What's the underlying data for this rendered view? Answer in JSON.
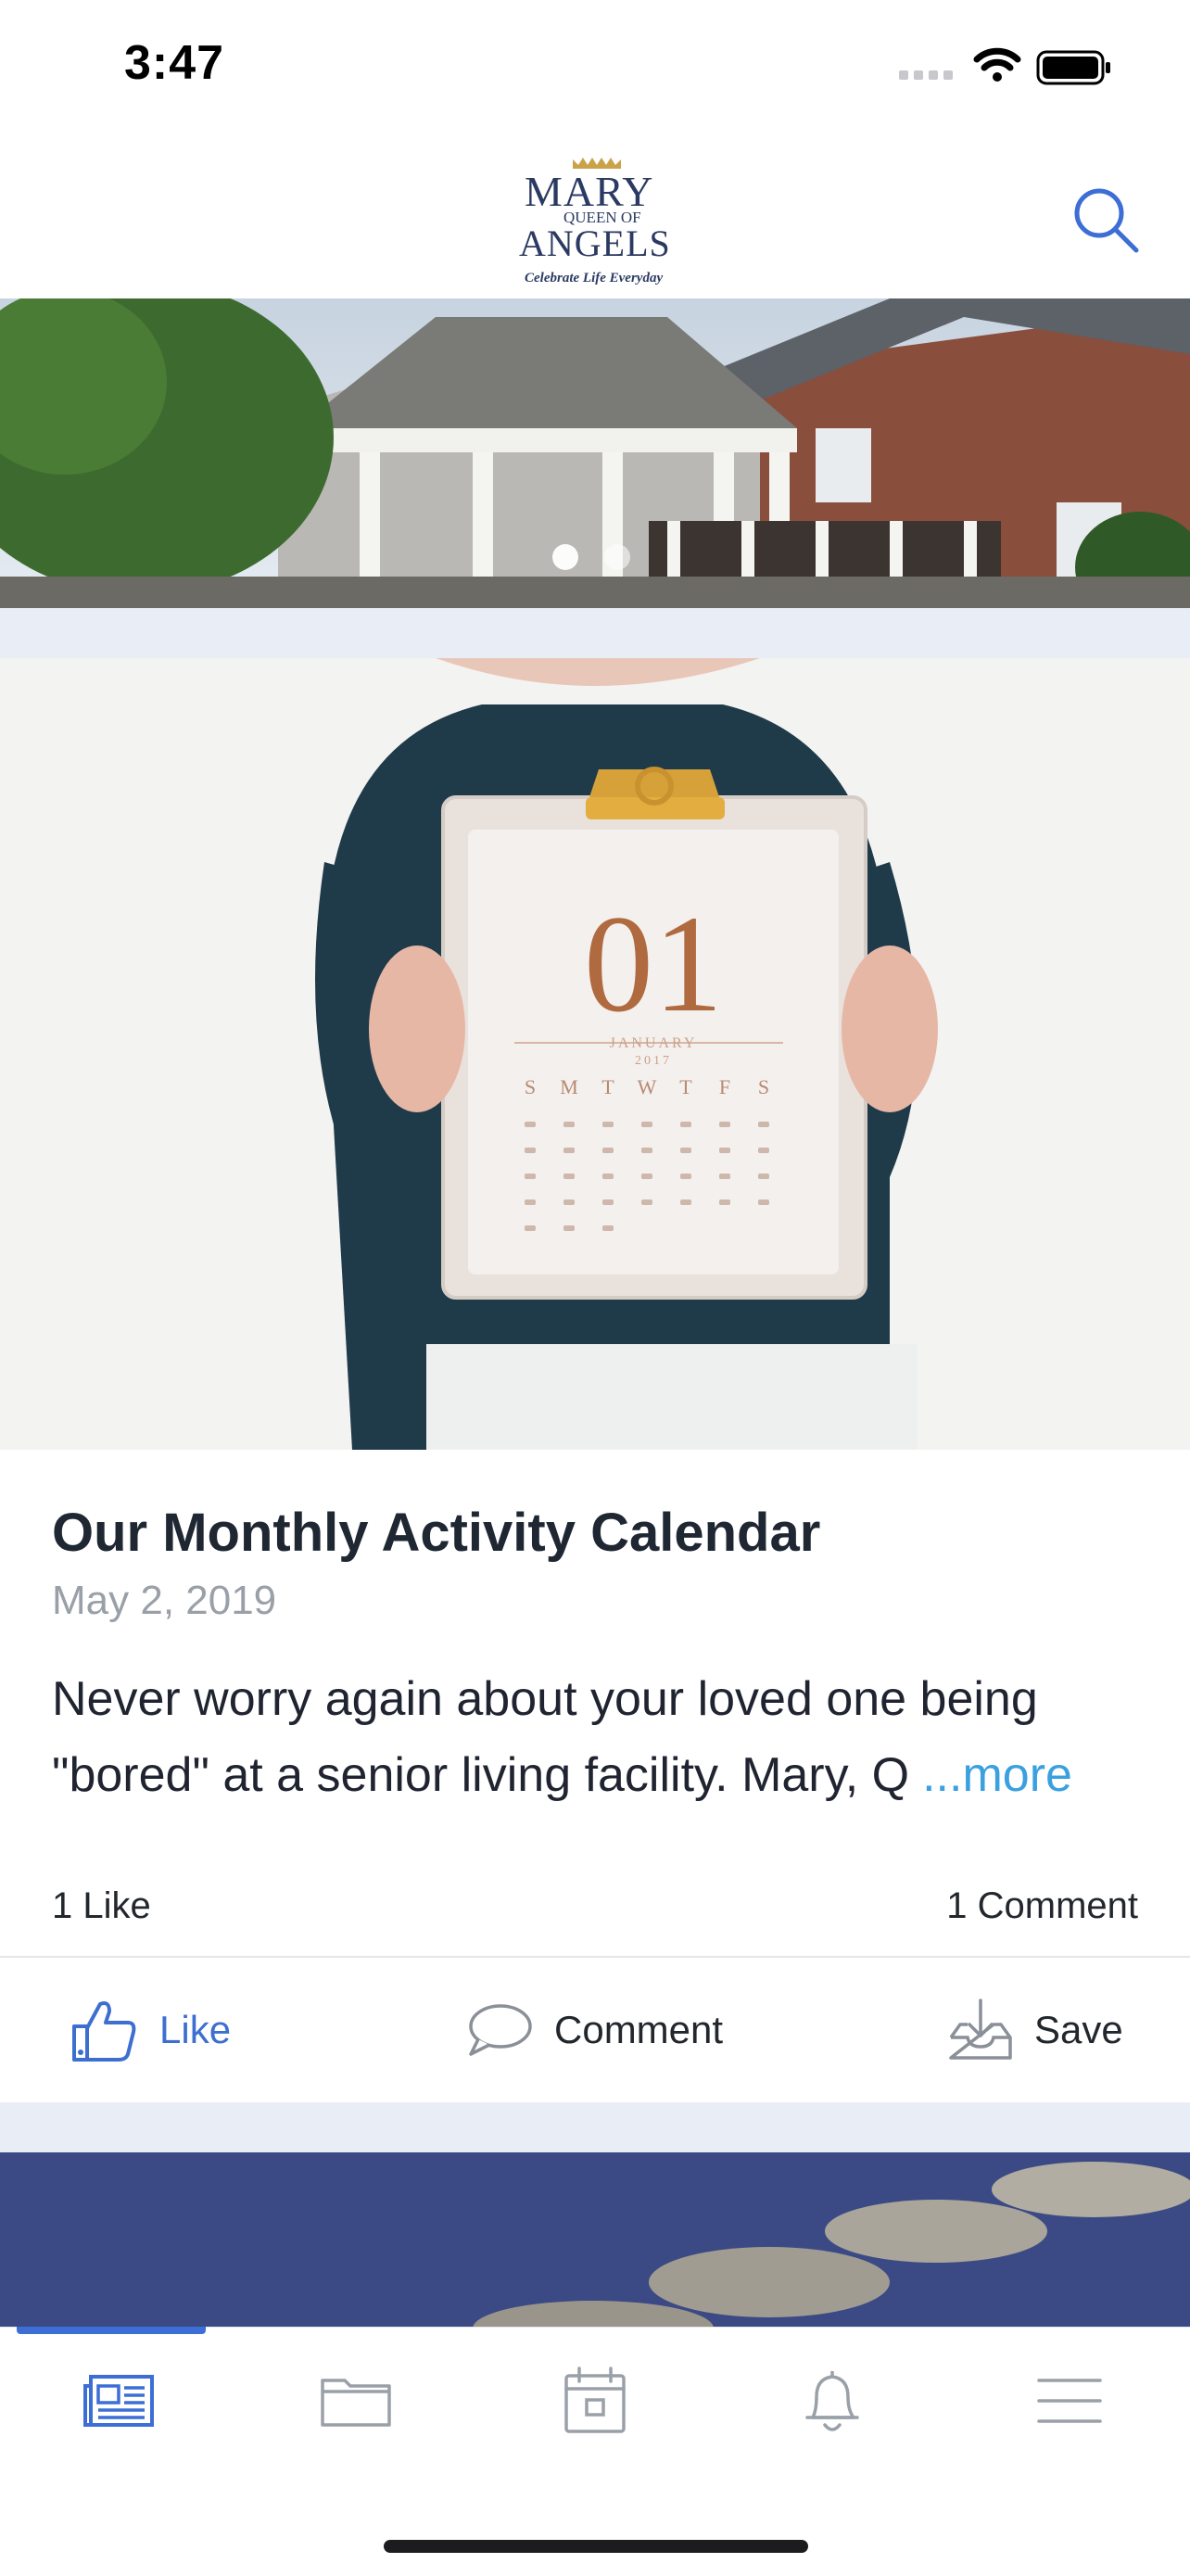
{
  "status_bar": {
    "time": "3:47"
  },
  "header": {
    "logo": {
      "line1": "MARY",
      "line2": "QUEEN OF",
      "line3": "ANGELS",
      "tagline": "Celebrate Life Everyday"
    },
    "search_icon": "search-icon"
  },
  "carousel": {
    "slide_count": 2,
    "active_index": 0
  },
  "post": {
    "image_text": {
      "number": "01",
      "month": "JANUARY",
      "year": "2017",
      "weekdays": [
        "S",
        "M",
        "T",
        "W",
        "T",
        "F",
        "S"
      ]
    },
    "title": "Our Monthly Activity Calendar",
    "date": "May 2, 2019",
    "excerpt_line1": "Never worry again about your loved one being",
    "excerpt_line2": "\"bored\" at a senior living facility. Mary, Q",
    "more_label": "...more",
    "likes": "1 Like",
    "comments": "1 Comment",
    "actions": {
      "like": "Like",
      "comment": "Comment",
      "save": "Save"
    }
  },
  "tab_bar": {
    "tabs": [
      {
        "name": "news",
        "icon": "newspaper-icon",
        "active": true
      },
      {
        "name": "files",
        "icon": "folder-icon",
        "active": false
      },
      {
        "name": "calendar",
        "icon": "calendar-icon",
        "active": false
      },
      {
        "name": "notifications",
        "icon": "bell-icon",
        "active": false
      },
      {
        "name": "menu",
        "icon": "menu-icon",
        "active": false
      }
    ]
  },
  "colors": {
    "accent": "#3c6ed6",
    "more_link": "#3aa0e0",
    "gap": "#e9eef6"
  }
}
